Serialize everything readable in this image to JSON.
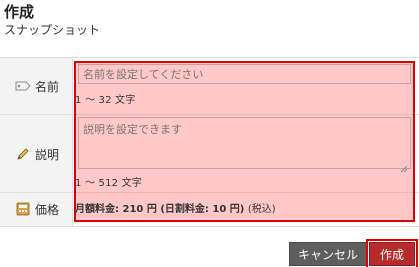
{
  "header": {
    "title": "作成",
    "subtitle": "スナップショット"
  },
  "form": {
    "name": {
      "label": "名前",
      "icon": "tag-icon",
      "placeholder": "名前を設定してください",
      "value": "",
      "hint": "1 ～ 32 文字"
    },
    "description": {
      "label": "説明",
      "icon": "pencil-icon",
      "placeholder": "説明を設定できます",
      "value": "",
      "hint": "1 ～ 512 文字"
    },
    "price": {
      "label": "価格",
      "icon": "calculator-icon",
      "text": "月額料金: 210 円 (日割料金: 10 円)",
      "tax": "(税込)"
    }
  },
  "buttons": {
    "cancel": "キャンセル",
    "create": "作成"
  },
  "colors": {
    "highlight_border": "#d90000",
    "cancel_bg": "#5e5e5e",
    "create_bg": "#b62b2b"
  }
}
